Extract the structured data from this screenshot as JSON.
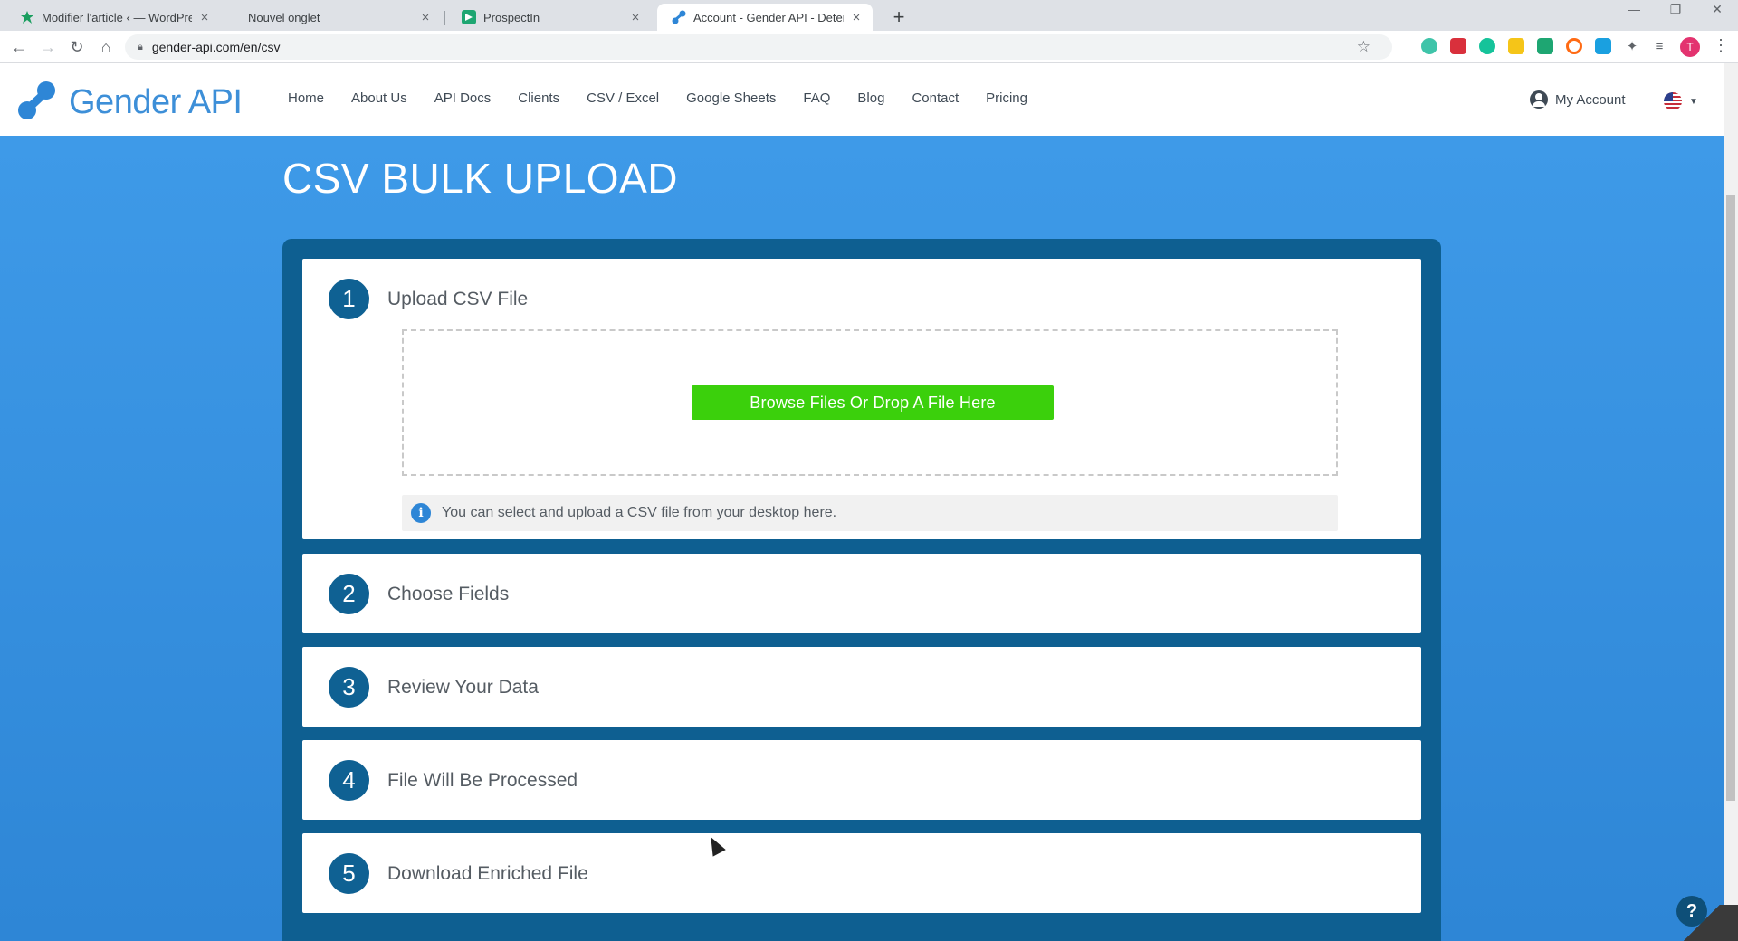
{
  "browser": {
    "tabs": [
      {
        "title": "Modifier l'article ‹ — WordPress",
        "close": "×"
      },
      {
        "title": "Nouvel onglet",
        "close": "×"
      },
      {
        "title": "ProspectIn",
        "close": "×"
      },
      {
        "title": "Account - Gender API - Determin",
        "close": "×"
      }
    ],
    "new_tab": "+",
    "window_controls": {
      "minimize": "—",
      "restore": "❐",
      "close": "✕"
    },
    "url": "gender-api.com/en/csv",
    "profile_initial": "T",
    "accent": "#3d8fd8"
  },
  "header": {
    "logo_text": "Gender API",
    "nav": [
      "Home",
      "About Us",
      "API Docs",
      "Clients",
      "CSV / Excel",
      "Google Sheets",
      "FAQ",
      "Blog",
      "Contact",
      "Pricing"
    ],
    "account_label": "My Account"
  },
  "page": {
    "title": "CSV BULK UPLOAD"
  },
  "steps": [
    {
      "num": "1",
      "title": "Upload CSV File"
    },
    {
      "num": "2",
      "title": "Choose Fields"
    },
    {
      "num": "3",
      "title": "Review Your Data"
    },
    {
      "num": "4",
      "title": "File Will Be Processed"
    },
    {
      "num": "5",
      "title": "Download Enriched File"
    }
  ],
  "upload": {
    "button_label": "Browse Files Or Drop A File Here",
    "info_text": "You can select and upload a CSV file from your desktop here.",
    "info_icon": "i"
  },
  "help_label": "?",
  "colors": {
    "hero_blue": "#3e9ae8",
    "panel_blue": "#0e5f91",
    "button_green": "#3bd00c"
  }
}
